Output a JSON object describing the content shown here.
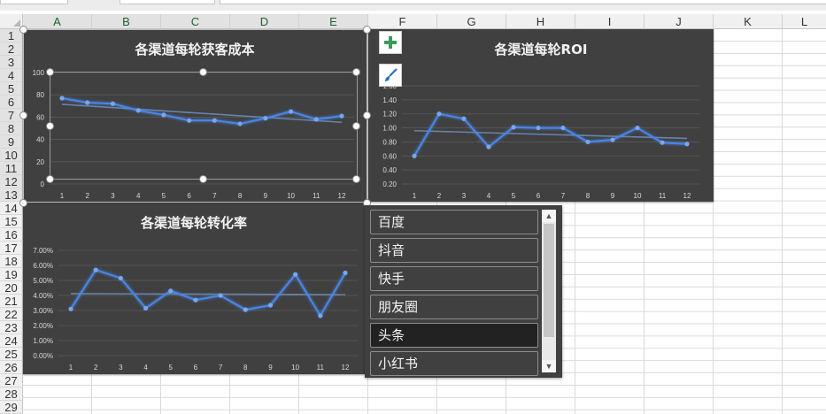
{
  "sheet": {
    "columns": [
      "A",
      "B",
      "C",
      "D",
      "E",
      "F",
      "G",
      "H",
      "I",
      "J",
      "K",
      "L"
    ],
    "rows": [
      "1",
      "2",
      "3",
      "4",
      "5",
      "6",
      "7",
      "8",
      "9",
      "10",
      "11",
      "12",
      "13",
      "14",
      "15",
      "16",
      "17",
      "18",
      "19",
      "20",
      "21",
      "22",
      "23",
      "24",
      "25",
      "26",
      "27",
      "28",
      "29"
    ]
  },
  "tools": {
    "add_icon": "plus-icon",
    "style_icon": "brush-icon"
  },
  "colors": {
    "chart_bg": "#404040",
    "line": "#4a86e8",
    "trend": "#6f8fbf"
  },
  "slicer": {
    "items": [
      "百度",
      "抖音",
      "快手",
      "朋友圈",
      "头条",
      "小红书"
    ],
    "selected": "头条"
  },
  "chart_data": [
    {
      "type": "line",
      "title": "各渠道每轮获客成本",
      "categories": [
        "1",
        "2",
        "3",
        "4",
        "5",
        "6",
        "7",
        "8",
        "9",
        "10",
        "11",
        "12"
      ],
      "series": [
        {
          "values": [
            77,
            73,
            72,
            66,
            62,
            57,
            57,
            54,
            59,
            65,
            58,
            61
          ]
        }
      ],
      "trendline": true,
      "yticks": [
        "0",
        "20",
        "40",
        "60",
        "80",
        "100"
      ],
      "ylim": [
        0,
        100
      ],
      "grid": true
    },
    {
      "type": "line",
      "title": "各渠道每轮ROI",
      "categories": [
        "1",
        "2",
        "3",
        "4",
        "5",
        "6",
        "7",
        "8",
        "9",
        "10",
        "11",
        "12"
      ],
      "series": [
        {
          "values": [
            0.6,
            1.2,
            1.13,
            0.73,
            1.01,
            1.0,
            1.0,
            0.8,
            0.83,
            1.0,
            0.79,
            0.77
          ]
        }
      ],
      "trendline": true,
      "yticks": [
        "0.20",
        "0.40",
        "0.60",
        "0.80",
        "1.00",
        "1.20",
        "1.40",
        "1.60"
      ],
      "ylim": [
        0.2,
        1.6
      ],
      "grid": true
    },
    {
      "type": "line",
      "title": "各渠道每轮转化率",
      "categories": [
        "1",
        "2",
        "3",
        "4",
        "5",
        "6",
        "7",
        "8",
        "9",
        "10",
        "11",
        "12"
      ],
      "series": [
        {
          "values": [
            3.1,
            5.7,
            5.15,
            3.15,
            4.3,
            3.7,
            4.0,
            3.05,
            3.35,
            5.4,
            2.65,
            5.5
          ]
        }
      ],
      "trendline": true,
      "yticks": [
        "0.00%",
        "1.00%",
        "2.00%",
        "3.00%",
        "4.00%",
        "5.00%",
        "6.00%",
        "7.00%"
      ],
      "ylim": [
        0,
        7
      ],
      "grid": true
    }
  ]
}
